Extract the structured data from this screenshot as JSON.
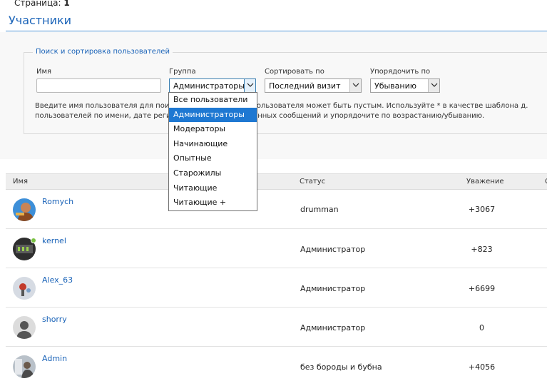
{
  "pagination": {
    "label": "Страница:",
    "page": "1"
  },
  "page_title": "Участники",
  "filter": {
    "legend": "Поиск и сортировка пользователей",
    "name_label": "Имя",
    "name_value": "",
    "group_label": "Группа",
    "group_value": "Администраторы",
    "sort_label": "Сортировать по",
    "sort_value": "Последний визит",
    "order_label": "Упорядочить по",
    "order_value": "Убыванию",
    "help_line1_a": "Введите имя пользователя для поис",
    "help_line1_b": "у. Имя пользователя может быть пустым. Используйте * в качестве шаблона д.",
    "help_line2_a": "пользователей по имени, дате регис",
    "help_line2_b": "переданных сообщений и упорядочите по возрастанию/убыванию."
  },
  "group_dropdown": {
    "options": [
      "Все пользователи",
      "Администраторы",
      "Модераторы",
      "Начинающие",
      "Опытные",
      "Старожилы",
      "Читающие",
      "Читающие +"
    ],
    "selected_index": 1
  },
  "table": {
    "headers": {
      "name": "Имя",
      "status": "Статус",
      "reputation": "Уважение",
      "extra": "С"
    },
    "rows": [
      {
        "name": "Romych",
        "status": "drumman",
        "reputation": "+3067",
        "avatar": "photo-avatar",
        "online": false
      },
      {
        "name": "kernel",
        "status": "Администратор",
        "reputation": "+823",
        "avatar": "photo-avatar",
        "online": true
      },
      {
        "name": "Alex_63",
        "status": "Администратор",
        "reputation": "+6699",
        "avatar": "photo-avatar",
        "online": false
      },
      {
        "name": "shorry",
        "status": "Администратор",
        "reputation": "0",
        "avatar": "default-avatar",
        "online": false
      },
      {
        "name": "Admin",
        "status": "без бороды и бубна",
        "reputation": "+4056",
        "avatar": "photo-avatar",
        "online": false
      }
    ]
  },
  "colors": {
    "link": "#1a63b8",
    "selected_option": "#1e78d2",
    "online": "#7ac142"
  }
}
